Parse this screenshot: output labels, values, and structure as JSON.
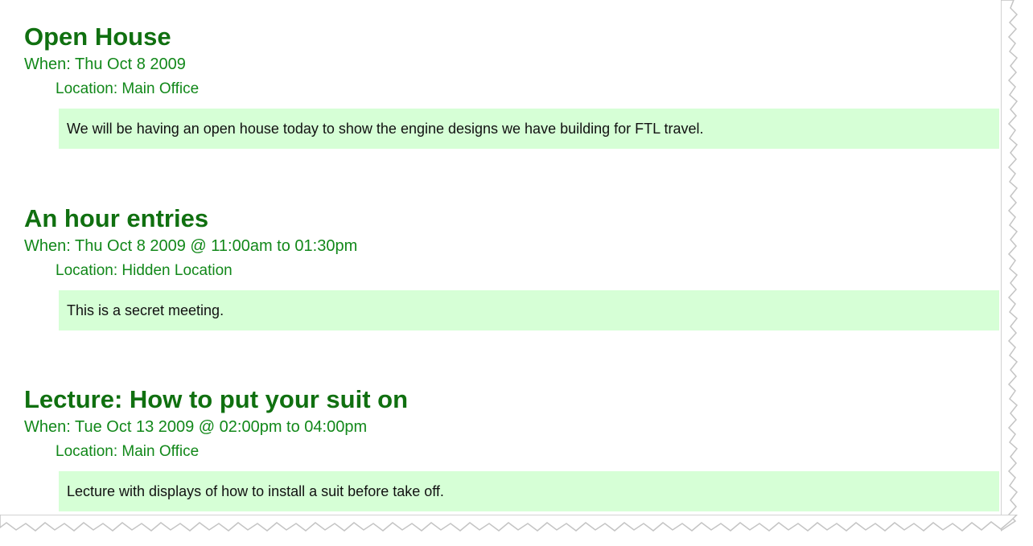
{
  "events": [
    {
      "title": "Open House",
      "when": "When: Thu Oct 8 2009",
      "location": "Location: Main Office",
      "description": "We will be having an open house today to show the engine designs we have building for FTL travel."
    },
    {
      "title": "An hour entries",
      "when": "When: Thu Oct 8 2009 @ 11:00am to 01:30pm",
      "location": "Location: Hidden Location",
      "description": "This is a secret meeting."
    },
    {
      "title": "Lecture: How to put your suit on",
      "when": "When: Tue Oct 13 2009 @ 02:00pm to 04:00pm",
      "location": "Location: Main Office",
      "description": "Lecture with displays of how to install a suit before take off."
    }
  ],
  "colors": {
    "title": "#107010",
    "meta": "#12881a",
    "description_background": "#d6ffd6"
  }
}
